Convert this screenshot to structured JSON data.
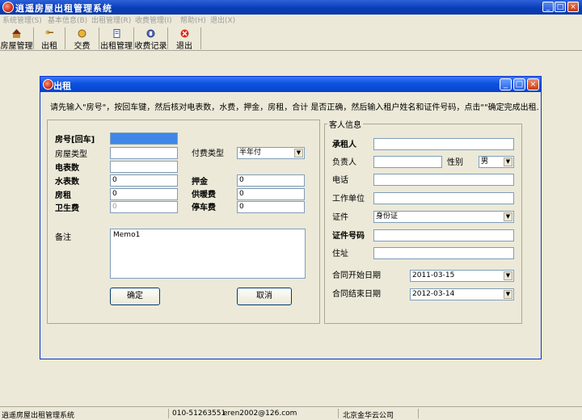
{
  "window": {
    "title": "逍遥房屋出租管理系统"
  },
  "menu": [
    "系统管理(S)",
    "基本信息(B)",
    "出租管理(R)",
    "收费管理(I)",
    "帮助(H)",
    "退出(X)"
  ],
  "toolbar": [
    "房屋管理",
    "出租",
    "交费",
    "出租管理",
    "收费记录",
    "退出"
  ],
  "dialog": {
    "title": "出租",
    "hint": "请先输入\"房号\"，按回车键，然后核对电表数，水费，押金，房租，合计 是否正确，然后输入租户姓名和证件号码，点击\"\"确定完成出租.",
    "labels": {
      "room_no": "房号[回车]",
      "room_type": "房屋类型",
      "meter": "电表数",
      "water": "水表数",
      "rent": "房租",
      "sanitation": "卫生费",
      "pay_type": "付费类型",
      "deposit": "押金",
      "heating": "供暖费",
      "parking": "停车费",
      "remark": "备注"
    },
    "values": {
      "room_no": "",
      "room_type": "",
      "meter": "",
      "water": "0",
      "rent": "0",
      "sanitation": "0",
      "pay_type": "半年付",
      "deposit": "0",
      "heating": "0",
      "parking": "0",
      "remark": "Memo1"
    },
    "guest": {
      "group_label": "客人信息",
      "labels": {
        "lessee": "承租人",
        "principal": "负责人",
        "gender": "性别",
        "phone": "电话",
        "employer": "工作单位",
        "id_type": "证件",
        "id_no": "证件号码",
        "address": "住址",
        "start_date": "合同开始日期",
        "end_date": "合同结束日期"
      },
      "values": {
        "lessee": "",
        "principal": "",
        "gender": "男",
        "phone": "",
        "employer": "",
        "id_type": "身份证",
        "id_no": "",
        "address": "",
        "start_date": "2011-03-15",
        "end_date": "2012-03-14"
      }
    },
    "buttons": {
      "ok": "确定",
      "cancel": "取消"
    }
  },
  "status": {
    "app": "逍遥房屋出租管理系统",
    "phone": "010-51263551",
    "email": "eren2002@126.com",
    "company": "北京金华云公司"
  }
}
